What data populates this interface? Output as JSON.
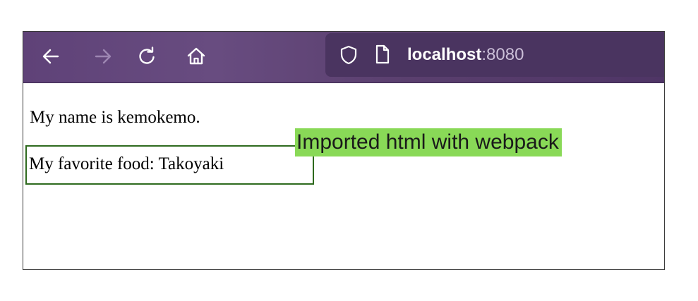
{
  "browser": {
    "url_host": "localhost",
    "url_port": ":8080",
    "toolbar_color": "#684c80",
    "icons": {
      "back": "arrow-left-icon",
      "forward": "arrow-right-icon",
      "reload": "reload-icon",
      "home": "home-icon",
      "shield": "shield-icon",
      "page": "page-icon"
    }
  },
  "page": {
    "name_text": "My name is kemokemo.",
    "food_text": "My favorite food: Takoyaki"
  },
  "annotation": {
    "label": "Imported html with webpack",
    "label_bg": "#89d957",
    "box_color": "#2e6a1e"
  }
}
